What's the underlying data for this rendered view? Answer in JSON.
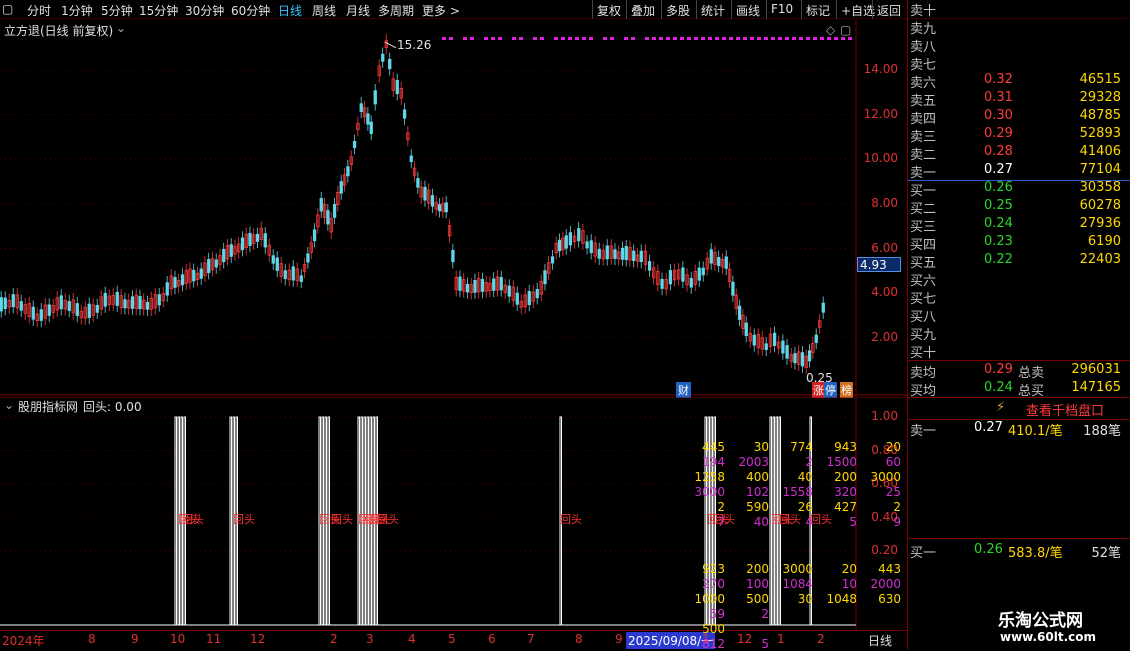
{
  "toolbar": {
    "periods": [
      "分时",
      "1分钟",
      "5分钟",
      "15分钟",
      "30分钟",
      "60分钟",
      "日线",
      "周线",
      "月线",
      "多周期",
      "更多 >"
    ],
    "active_period": "日线",
    "buttons": [
      "复权",
      "叠加",
      "多股",
      "统计",
      "画线",
      "F10",
      "标记",
      "+自选",
      "返回"
    ]
  },
  "main_chart": {
    "title": "立方退(日线 前复权)",
    "high_label": "15.26",
    "low_label": "0.25",
    "current_price": "4.93",
    "y_ticks": [
      "14.00",
      "12.00",
      "10.00",
      "8.00",
      "6.00",
      "4.00",
      "2.00"
    ],
    "badges": [
      "财",
      "涨",
      "停",
      "榜"
    ]
  },
  "indicator": {
    "title": "股朋指标网",
    "value_label": "回头: 0.00",
    "y_ticks": [
      "1.00",
      "0.80",
      "0.60",
      "0.40",
      "0.20"
    ],
    "signal_label": "回头"
  },
  "x_axis": {
    "labels": [
      "2024年",
      "8",
      "9",
      "10",
      "11",
      "12",
      "2",
      "3",
      "4",
      "5",
      "6",
      "7",
      "8",
      "9",
      "2025/09/08/一",
      "1",
      "12",
      "1",
      "1",
      "2"
    ],
    "cursor_date": "2025/09/08/一",
    "period": "日线"
  },
  "order_book": {
    "sells": [
      {
        "label": "卖十",
        "price": "",
        "vol": ""
      },
      {
        "label": "卖九",
        "price": "",
        "vol": ""
      },
      {
        "label": "卖八",
        "price": "",
        "vol": ""
      },
      {
        "label": "卖七",
        "price": "",
        "vol": ""
      },
      {
        "label": "卖六",
        "price": "0.32",
        "vol": "46515"
      },
      {
        "label": "卖五",
        "price": "0.31",
        "vol": "29328"
      },
      {
        "label": "卖四",
        "price": "0.30",
        "vol": "48785"
      },
      {
        "label": "卖三",
        "price": "0.29",
        "vol": "52893"
      },
      {
        "label": "卖二",
        "price": "0.28",
        "vol": "41406"
      },
      {
        "label": "卖一",
        "price": "0.27",
        "vol": "77104"
      }
    ],
    "buys": [
      {
        "label": "买一",
        "price": "0.26",
        "vol": "30358"
      },
      {
        "label": "买二",
        "price": "0.25",
        "vol": "60278"
      },
      {
        "label": "买三",
        "price": "0.24",
        "vol": "27936"
      },
      {
        "label": "买四",
        "price": "0.23",
        "vol": "6190"
      },
      {
        "label": "买五",
        "price": "0.22",
        "vol": "22403"
      },
      {
        "label": "买六",
        "price": "",
        "vol": ""
      },
      {
        "label": "买七",
        "price": "",
        "vol": ""
      },
      {
        "label": "买八",
        "price": "",
        "vol": ""
      },
      {
        "label": "买九",
        "price": "",
        "vol": ""
      },
      {
        "label": "买十",
        "price": "",
        "vol": ""
      }
    ],
    "avg_sell_label": "卖均",
    "avg_sell": "0.29",
    "total_sell_label": "总卖",
    "total_sell": "296031",
    "avg_buy_label": "买均",
    "avg_buy": "0.24",
    "total_buy_label": "总买",
    "total_buy": "147165",
    "thousand_link": "查看千档盘口"
  },
  "queue_sell": {
    "label": "卖一",
    "price": "0.27",
    "avg": "410.1/笔",
    "count": "188笔",
    "rows": [
      [
        "445",
        "30",
        "774",
        "943",
        "20"
      ],
      [
        "194",
        "2003",
        "2",
        "1500",
        "60"
      ],
      [
        "1258",
        "400",
        "40",
        "200",
        "3000"
      ],
      [
        "3000",
        "102",
        "1558",
        "320",
        "25"
      ],
      [
        "2",
        "590",
        "26",
        "427",
        "2"
      ],
      [
        "7",
        "40",
        "4",
        "5",
        "9"
      ]
    ]
  },
  "queue_buy": {
    "label": "买一",
    "price": "0.26",
    "avg": "583.8/笔",
    "count": "52笔",
    "rows": [
      [
        "923",
        "200",
        "3000",
        "20",
        "443"
      ],
      [
        "270",
        "100",
        "1084",
        "10",
        "2000"
      ],
      [
        "1000",
        "500",
        "30",
        "1048",
        "630"
      ],
      [
        "59",
        "2",
        "",
        "",
        ""
      ],
      [
        "500",
        "",
        "",
        "",
        ""
      ],
      [
        "812",
        "5",
        "",
        "",
        ""
      ]
    ]
  },
  "watermark": {
    "title": "乐淘公式网",
    "url": "www.60lt.com"
  },
  "colors": {
    "up": "#ff3b3b",
    "down": "#2bd62b",
    "axis": "#e03030",
    "grid": "#7a0000",
    "accent": "#39c4ff"
  }
}
